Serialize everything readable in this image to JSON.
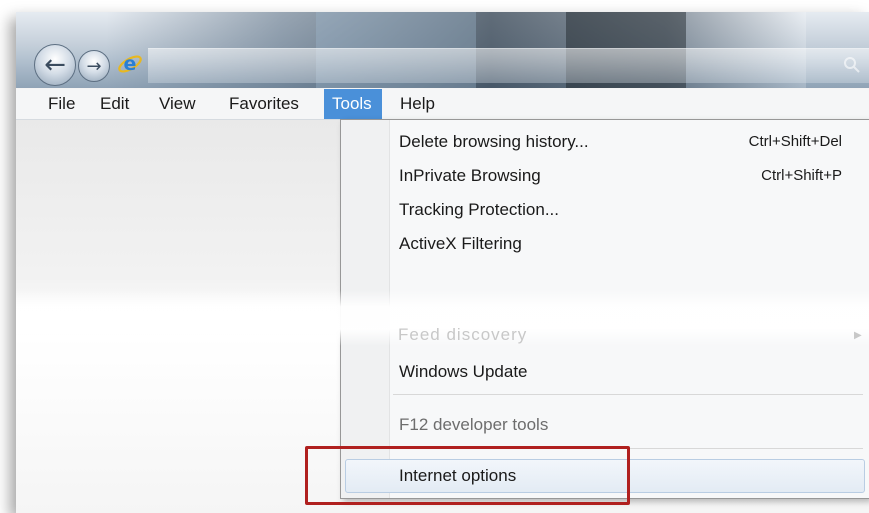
{
  "menubar": {
    "items": [
      {
        "label": "File"
      },
      {
        "label": "Edit"
      },
      {
        "label": "View"
      },
      {
        "label": "Favorites"
      },
      {
        "label": "Tools"
      },
      {
        "label": "Help"
      }
    ],
    "active": "Tools"
  },
  "tools_menu": {
    "items": [
      {
        "label": "Delete browsing history...",
        "shortcut": "Ctrl+Shift+Del"
      },
      {
        "label": "InPrivate Browsing",
        "shortcut": "Ctrl+Shift+P"
      },
      {
        "label": "Tracking Protection..."
      },
      {
        "label": "ActiveX Filtering"
      },
      {
        "label": "Feed discovery"
      },
      {
        "label": "Windows Update"
      },
      {
        "label": "F12 developer tools"
      },
      {
        "label": "Internet options"
      }
    ]
  },
  "icons": {
    "back": "back-arrow-icon",
    "forward": "forward-arrow-icon",
    "browser": "internet-explorer-logo-icon",
    "search": "search-icon"
  },
  "colors": {
    "menu_active_bg": "#4a90d9",
    "highlight_box": "#b0201f",
    "hover_row": "#e3ebf4"
  }
}
